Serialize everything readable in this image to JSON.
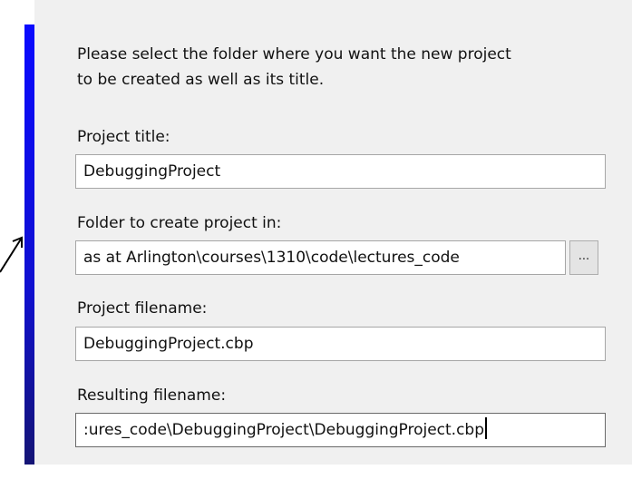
{
  "intro": {
    "line1": "Please select the folder where you want the new project",
    "line2": "to be created as well as its title."
  },
  "project_title": {
    "label": "Project title:",
    "value": "DebuggingProject"
  },
  "folder": {
    "label": "Folder to create project in:",
    "value": "as at Arlington\\courses\\1310\\code\\lectures_code",
    "browse_label": "..."
  },
  "project_filename": {
    "label": "Project filename:",
    "value": "DebuggingProject.cbp"
  },
  "resulting_filename": {
    "label": "Resulting filename:",
    "value": ":ures_code\\DebuggingProject\\DebuggingProject.cbp"
  },
  "colors": {
    "accent_bar": "#1010d0",
    "panel_background": "#f0f0f0"
  }
}
